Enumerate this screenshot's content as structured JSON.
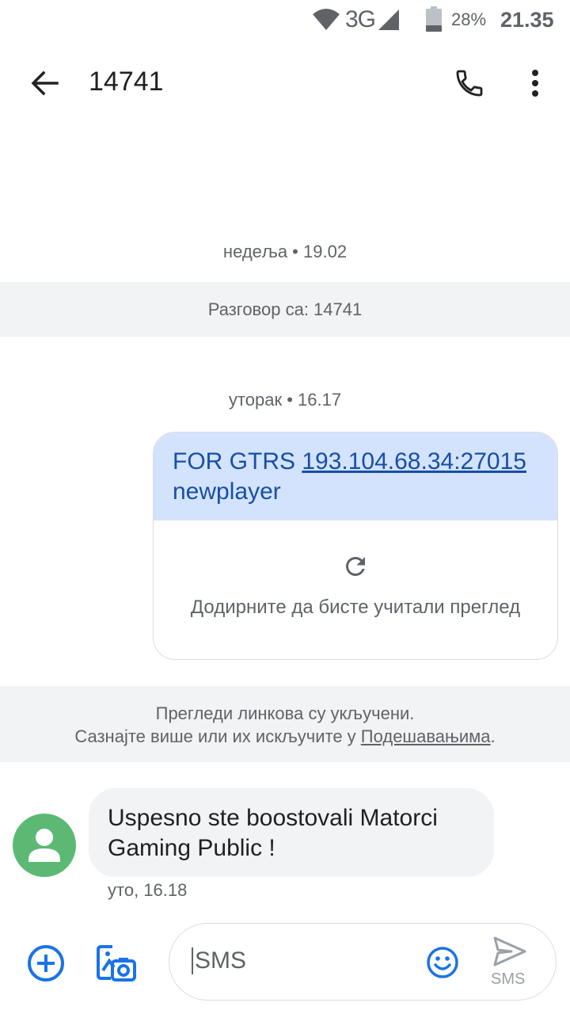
{
  "status_bar": {
    "network": "3G",
    "battery_percent": "28%",
    "time": "21.35",
    "icons": [
      "wifi-icon",
      "signal-icon",
      "battery-icon"
    ]
  },
  "toolbar": {
    "title": "14741",
    "icons": [
      "back-arrow-icon",
      "phone-icon",
      "more-vert-icon"
    ]
  },
  "conversation": {
    "day_separator_1": "недеља • 19.02",
    "conversation_with": "Разговор са: 14741",
    "day_separator_2": "уторак • 16.17",
    "outgoing_message": {
      "text_prefix": "FOR GTRS ",
      "link": "193.104.68.34:27015",
      "text_suffix": "newplayer"
    },
    "link_preview": {
      "icon": "refresh-icon",
      "label": "Додирните да бисте учитали преглед"
    },
    "link_preview_notice": {
      "line1": "Прегледи линкова су укључени.",
      "line2_prefix": "Сазнајте више или их искључите у ",
      "line2_link": "Подешавањима",
      "line2_suffix": "."
    },
    "incoming_message": {
      "text": "Uspesno ste boostovali Matorci Gaming Public !",
      "timestamp": "уто, 16.18",
      "avatar_icon": "person-avatar-icon"
    }
  },
  "compose": {
    "placeholder": "SMS",
    "send_label": "SMS",
    "icons": [
      "add-circle-icon",
      "gallery-camera-icon",
      "emoji-icon",
      "send-icon"
    ]
  },
  "colors": {
    "outgoing_bubble": "#d3e3fd",
    "outgoing_text": "#174ea6",
    "incoming_bubble": "#f1f3f4",
    "accent": "#1a73e8",
    "avatar": "#5bb974"
  }
}
